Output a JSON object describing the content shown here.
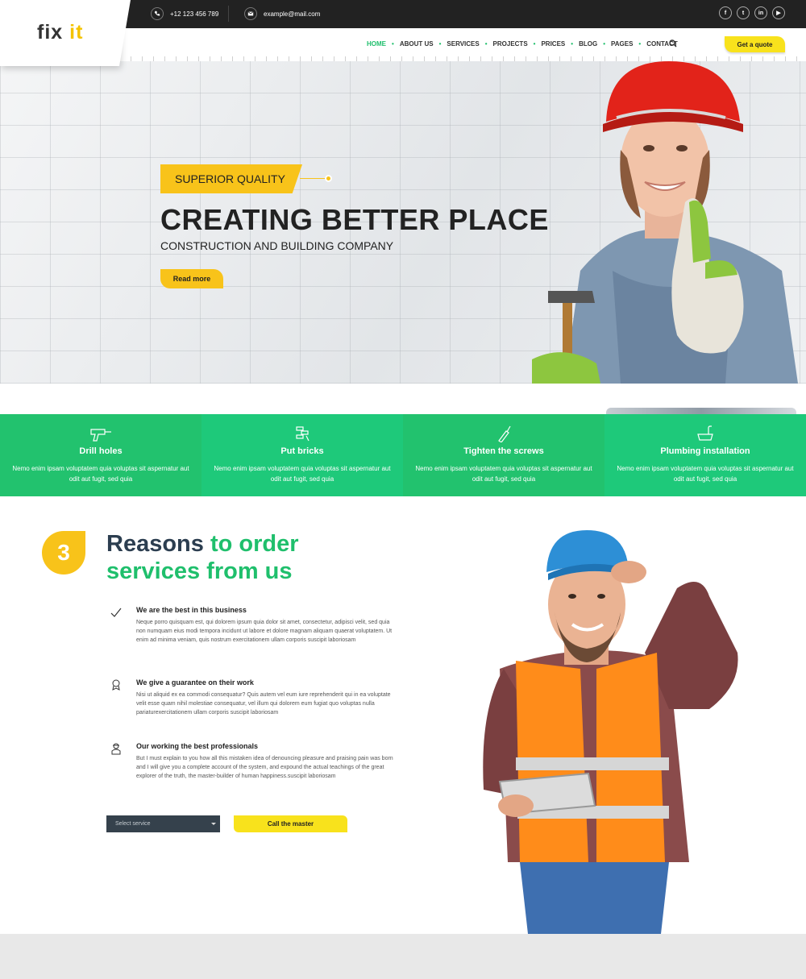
{
  "topbar": {
    "phone": "+12 123 456 789",
    "email": "example@mail.com",
    "social": [
      {
        "icon": "facebook-icon",
        "glyph": "f"
      },
      {
        "icon": "twitter-icon",
        "glyph": "t"
      },
      {
        "icon": "linkedin-icon",
        "glyph": "in"
      },
      {
        "icon": "youtube-icon",
        "glyph": "▶"
      }
    ]
  },
  "logo": {
    "part1": "fix ",
    "part2": "it"
  },
  "nav": {
    "items": [
      "HOME",
      "ABOUT US",
      "SERVICES",
      "PROJECTS",
      "PRICES",
      "BLOG",
      "PAGES",
      "CONTACT"
    ],
    "active": "HOME",
    "quote_label": "Get a quote"
  },
  "hero": {
    "tag": "SUPERIOR QUALITY",
    "title": "CREATING BETTER PLACE",
    "subtitle": "CONSTRUCTION AND BUILDING COMPANY",
    "button": "Read more"
  },
  "features": [
    {
      "icon": "drill-icon",
      "title": "Drill holes",
      "desc": "Nemo enim ipsam voluptatem quia voluptas sit aspernatur aut odit aut fugit, sed quia"
    },
    {
      "icon": "bricks-icon",
      "title": "Put bricks",
      "desc": "Nemo enim ipsam voluptatem quia voluptas sit aspernatur aut odit aut fugit, sed quia"
    },
    {
      "icon": "screwdriver-icon",
      "title": "Tighten the screws",
      "desc": "Nemo enim ipsam voluptatem quia voluptas sit aspernatur aut odit aut fugit, sed quia"
    },
    {
      "icon": "bathtub-icon",
      "title": "Plumbing installation",
      "desc": "Nemo enim ipsam voluptatem quia voluptas sit aspernatur aut odit aut fugit, sed quia"
    }
  ],
  "reasons": {
    "badge": "3",
    "title_dark": "Reasons",
    "title_green_1": " to order",
    "title_green_2": "services from us",
    "items": [
      {
        "icon": "checkmark-icon",
        "title": "We are the best in this business",
        "desc": "Neque porro quisquam est, qui dolorem ipsum quia dolor sit amet, consectetur, adipisci velit, sed quia non numquam eius modi tempora incidunt ut labore et dolore magnam aliquam quaerat voluptatem. Ut enim ad minima veniam, quis nostrum exercitationem ullam corporis suscipit laboriosam"
      },
      {
        "icon": "award-icon",
        "title": "We give a guarantee on their work",
        "desc": "Nisi ut aliquid ex ea commodi consequatur? Quis autem vel eum iure reprehenderit qui in ea voluptate velit esse quam nihil molestiae consequatur, vel illum qui dolorem eum fugiat quo voluptas nulla pariaturexercitationem ullam corporis suscipit laboriosam"
      },
      {
        "icon": "worker-icon",
        "title": "Our working the best professionals",
        "desc": "But I must explain to you how all this mistaken idea of denouncing pleasure and praising pain was born and I will give you a complete account of the system, and expound the actual teachings of the great explorer of the truth, the master-builder of human happiness.suscipit laboriosam"
      }
    ],
    "select_placeholder": "Select service",
    "call_button": "Call the master"
  },
  "colors": {
    "accent_yellow": "#f8c31a",
    "button_yellow": "#f8e21c",
    "green": "#1fbf6c",
    "dark": "#222222",
    "slate": "#2c3e50"
  }
}
